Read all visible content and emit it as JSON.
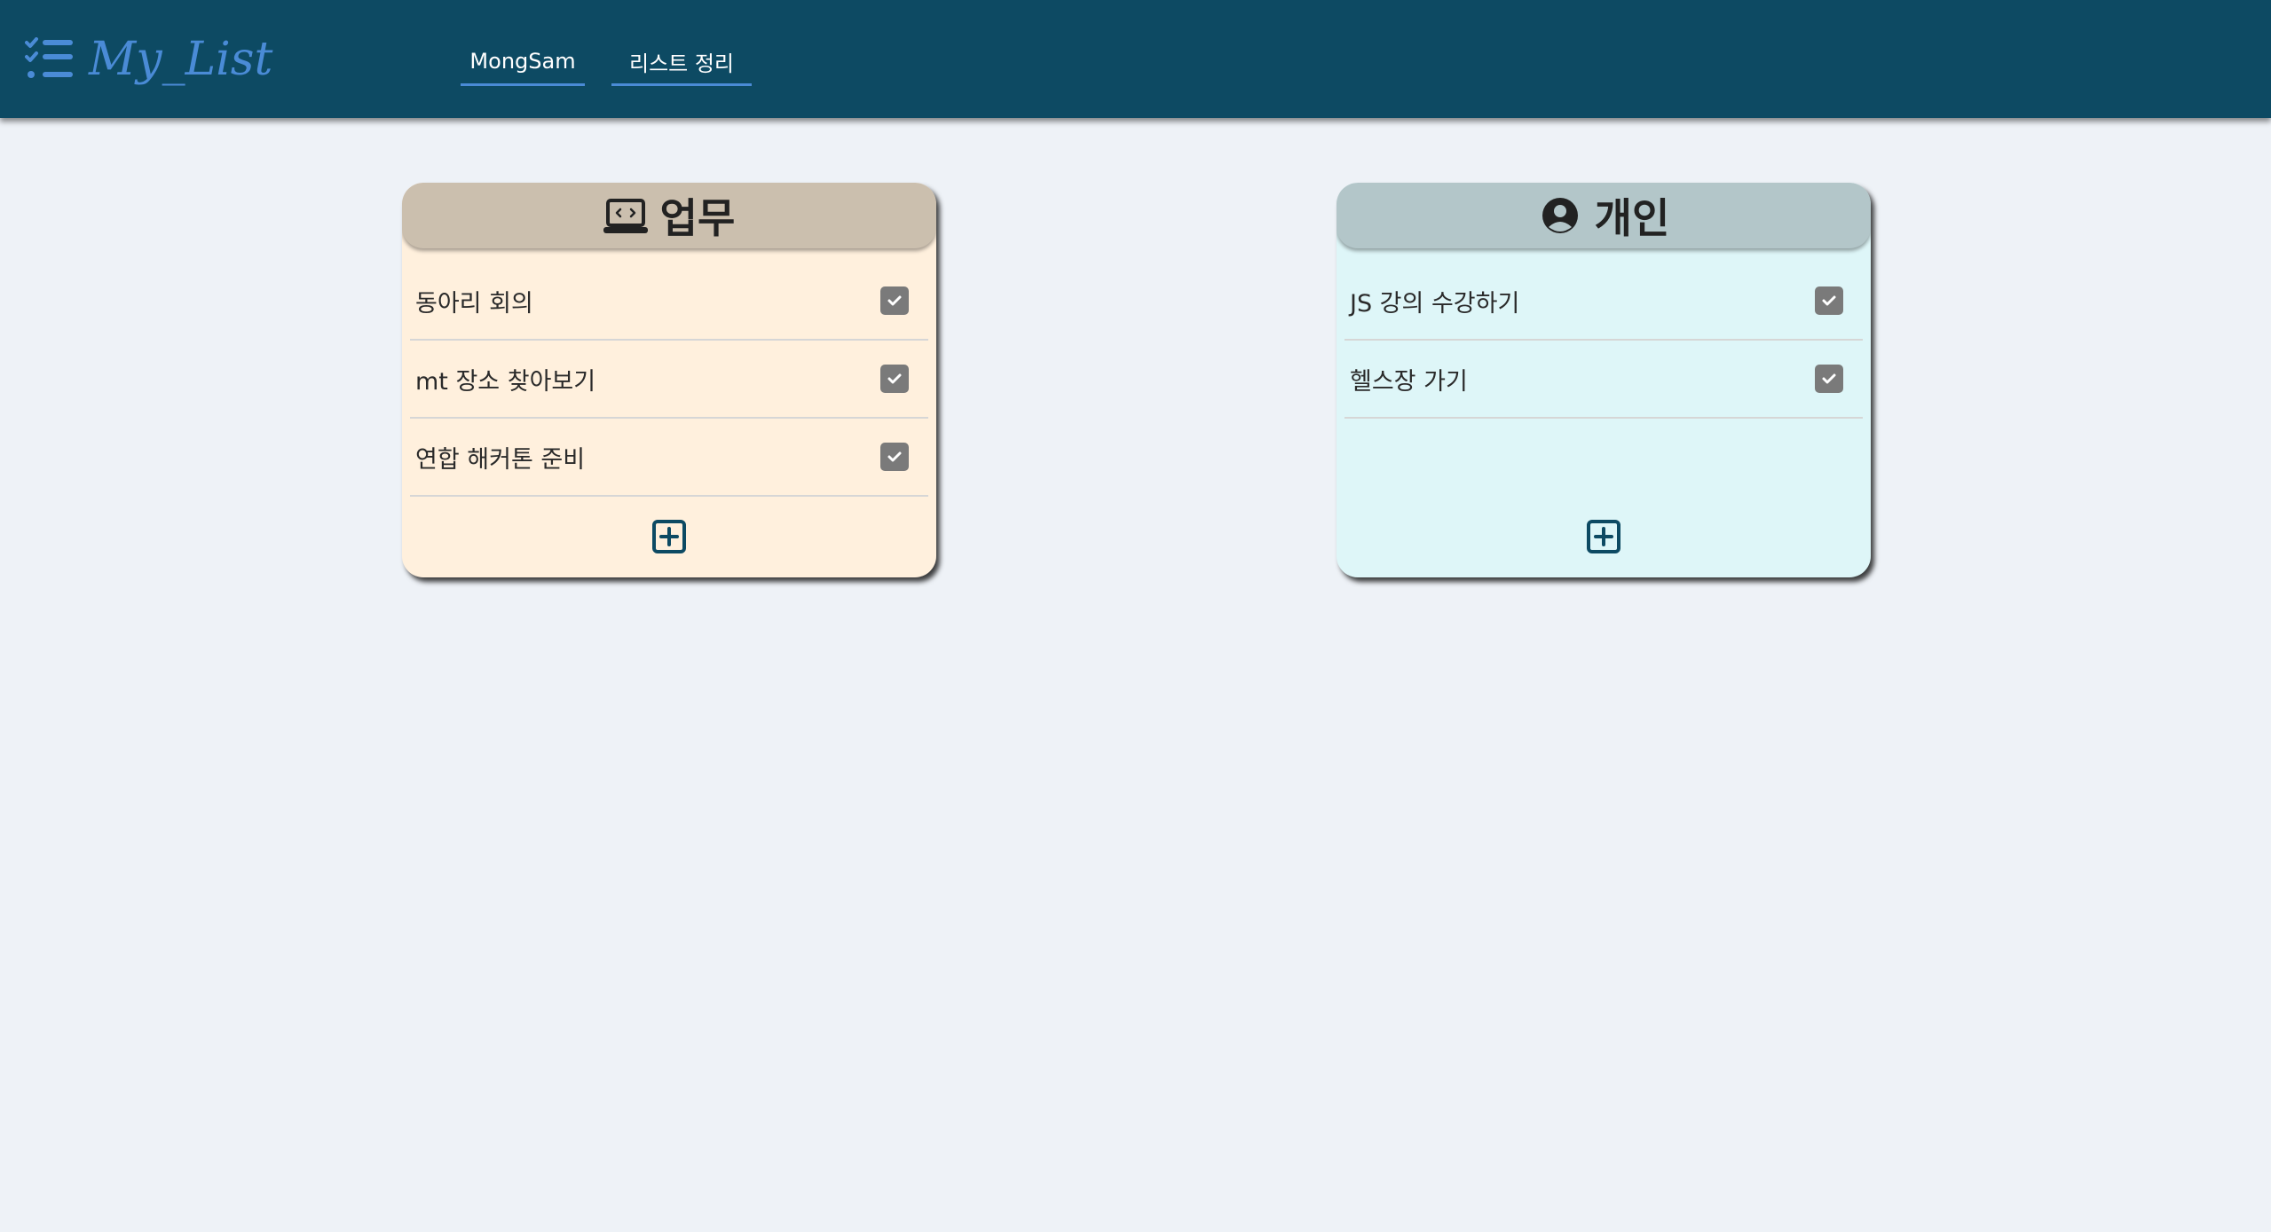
{
  "header": {
    "logo_text": "My_List",
    "logo_color": "#4a8bd6",
    "background": "#0d4a63",
    "nav": [
      {
        "label": "MongSam"
      },
      {
        "label": "리스트 정리"
      }
    ]
  },
  "cards": [
    {
      "title": "업무",
      "icon": "laptop-code-icon",
      "header_color": "#cbbfae",
      "body_color": "#fff0dd",
      "items": [
        {
          "text": "동아리 회의",
          "checked": true
        },
        {
          "text": "mt 장소 찾아보기",
          "checked": true
        },
        {
          "text": "연합 해커톤 준비",
          "checked": true
        }
      ],
      "add_icon": "plus-square-icon"
    },
    {
      "title": "개인",
      "icon": "user-circle-icon",
      "header_color": "#b3c6c9",
      "body_color": "#def6f8",
      "items": [
        {
          "text": "JS 강의 수강하기",
          "checked": true
        },
        {
          "text": "헬스장 가기",
          "checked": true
        }
      ],
      "add_icon": "plus-square-icon"
    }
  ]
}
